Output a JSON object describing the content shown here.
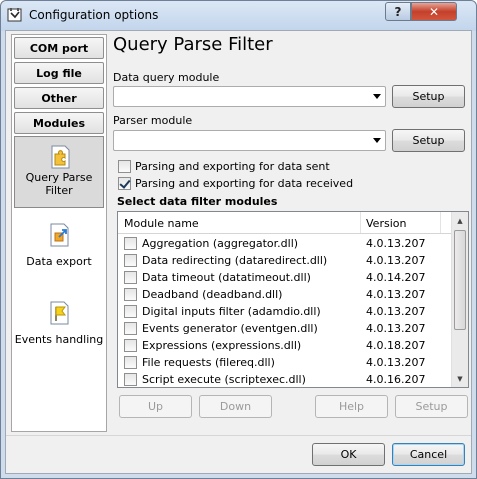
{
  "window": {
    "title": "Configuration options",
    "help_glyph": "?",
    "close_glyph": "✕"
  },
  "sidebar": {
    "tabs": [
      "COM port",
      "Log file",
      "Other",
      "Modules"
    ],
    "items": [
      {
        "label": "Query Parse Filter",
        "icon": "puzzle-icon",
        "active": true
      },
      {
        "label": "Data export",
        "icon": "data-export-icon",
        "active": false
      },
      {
        "label": "Events handling",
        "icon": "flag-document-icon",
        "active": false
      }
    ]
  },
  "main": {
    "title": "Query Parse Filter",
    "data_query_label": "Data query module",
    "data_query_value": "",
    "parser_label": "Parser module",
    "parser_value": "",
    "setup_label": "Setup",
    "check_sent": {
      "label": "Parsing and exporting for data sent",
      "checked": false
    },
    "check_received": {
      "label": "Parsing and exporting for data received",
      "checked": true
    },
    "section_title": "Select data filter modules",
    "table": {
      "columns": [
        "Module name",
        "Version"
      ],
      "rows": [
        {
          "name": "Aggregation (aggregator.dll)",
          "version": "4.0.13.207",
          "checked": false
        },
        {
          "name": "Data redirecting (dataredirect.dll)",
          "version": "4.0.13.207",
          "checked": false
        },
        {
          "name": "Data timeout (datatimeout.dll)",
          "version": "4.0.14.207",
          "checked": false
        },
        {
          "name": "Deadband (deadband.dll)",
          "version": "4.0.13.207",
          "checked": false
        },
        {
          "name": "Digital inputs filter (adamdio.dll)",
          "version": "4.0.13.207",
          "checked": false
        },
        {
          "name": "Events generator (eventgen.dll)",
          "version": "4.0.13.207",
          "checked": false
        },
        {
          "name": "Expressions (expressions.dll)",
          "version": "4.0.18.207",
          "checked": false
        },
        {
          "name": "File requests (filereq.dll)",
          "version": "4.0.13.207",
          "checked": false
        },
        {
          "name": "Script execute (scriptexec.dll)",
          "version": "4.0.16.207",
          "checked": false
        }
      ]
    },
    "buttons": {
      "up": "Up",
      "down": "Down",
      "help": "Help",
      "setup": "Setup"
    }
  },
  "footer": {
    "ok": "OK",
    "cancel": "Cancel"
  }
}
